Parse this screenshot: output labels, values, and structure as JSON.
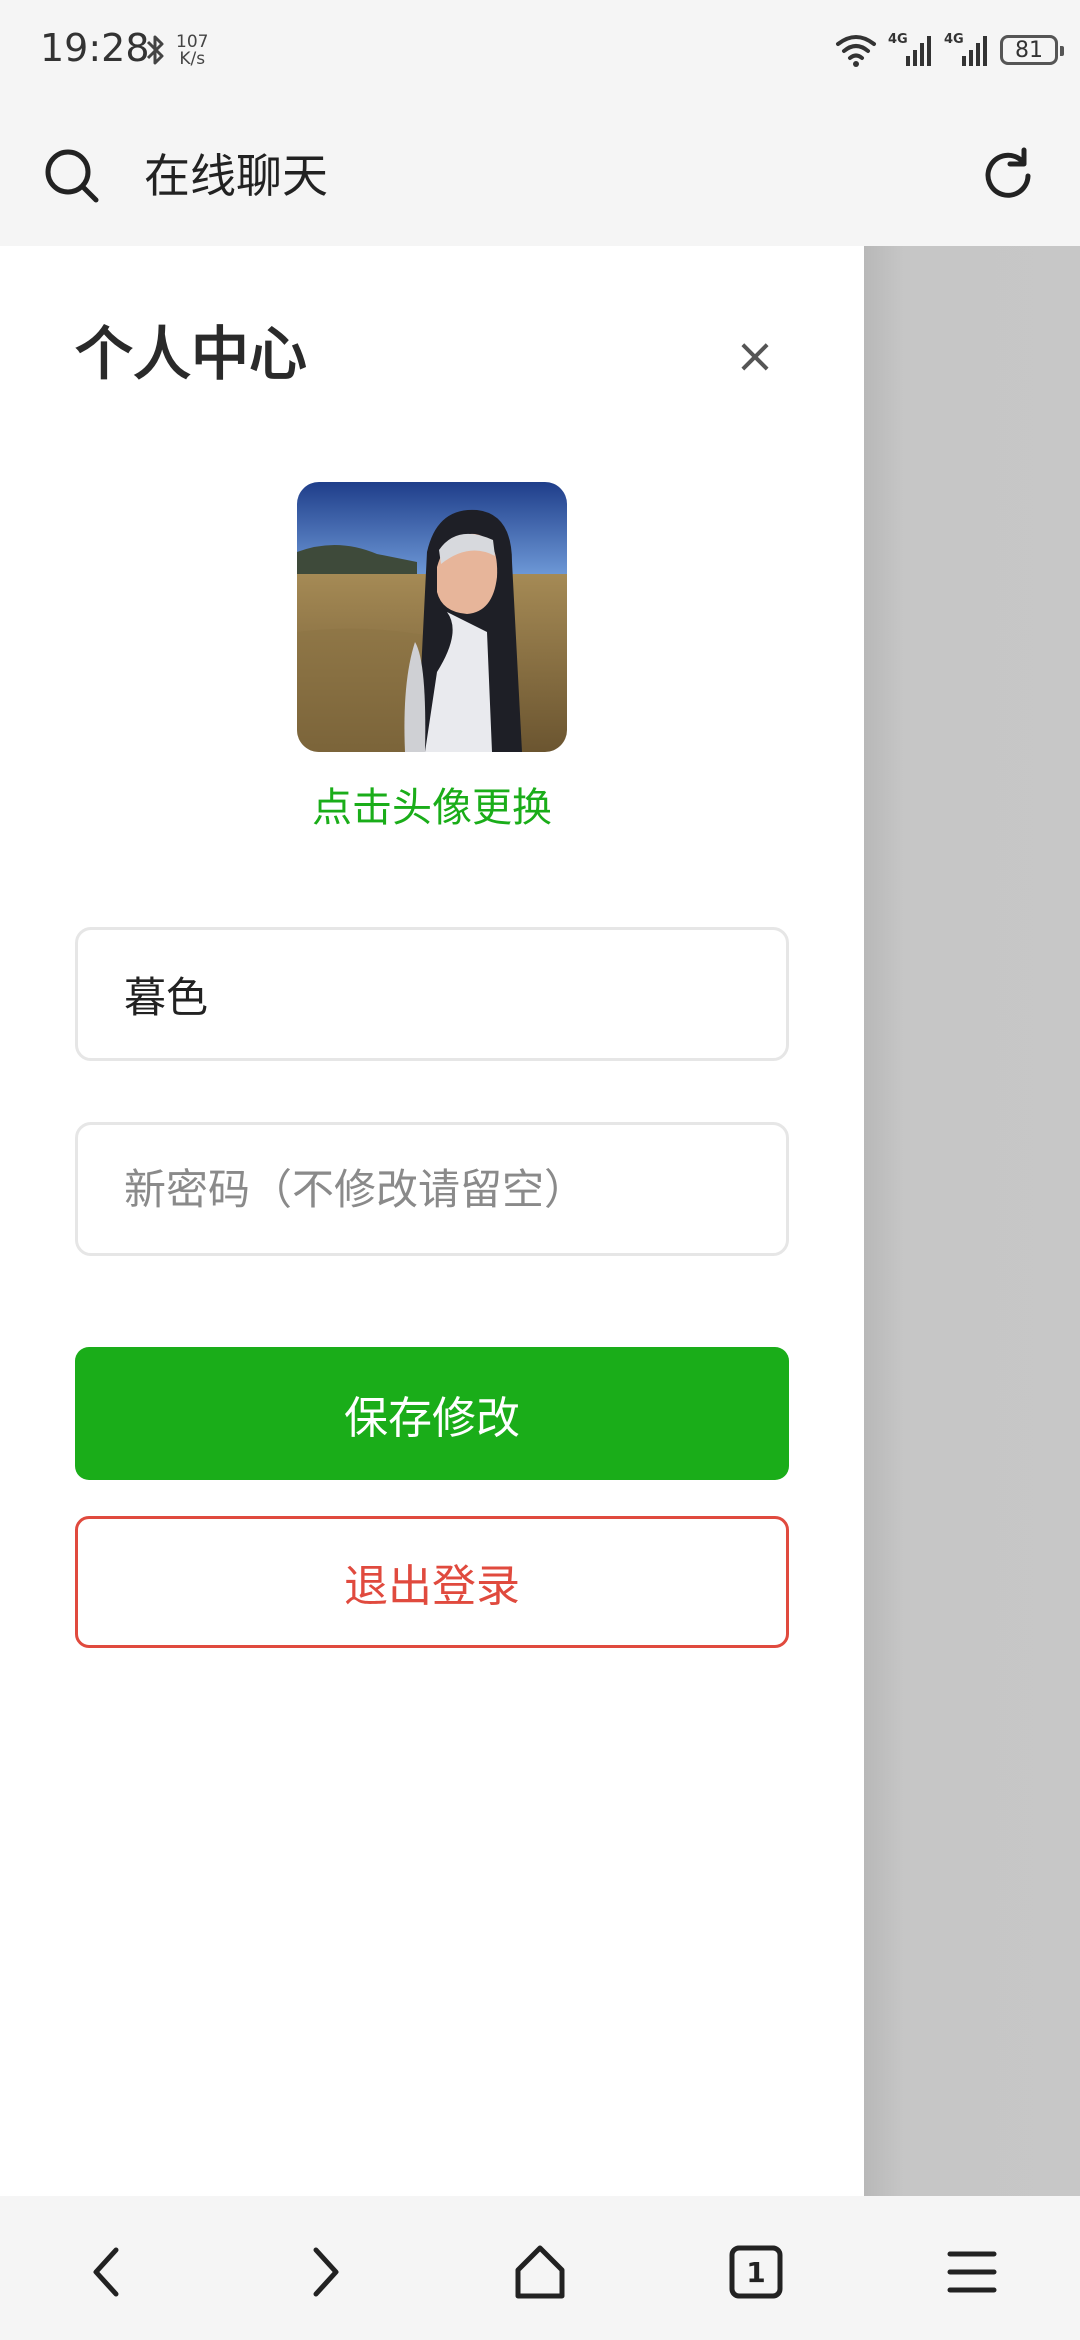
{
  "status_bar": {
    "time": "19:28",
    "net_speed_value": "107",
    "net_speed_unit": "K/s",
    "signal1_label": "4G",
    "signal2_label": "4G",
    "battery": "81"
  },
  "browser": {
    "title": "在线聊天"
  },
  "drawer": {
    "title": "个人中心",
    "close_label": "×",
    "avatar_hint": "点击头像更换",
    "nickname_value": "暮色",
    "password_placeholder": "新密码（不修改请留空）",
    "save_label": "保存修改",
    "logout_label": "退出登录"
  },
  "bottom_nav": {
    "tabs_count": "1"
  },
  "colors": {
    "accent_green": "#1aad19",
    "logout_red": "#e04a3e"
  },
  "icons": [
    "search-icon",
    "reload-icon",
    "close-icon",
    "back-icon",
    "forward-icon",
    "home-icon",
    "tabs-icon",
    "menu-icon",
    "bluetooth-icon",
    "wifi-icon",
    "signal-icon",
    "battery-icon"
  ]
}
